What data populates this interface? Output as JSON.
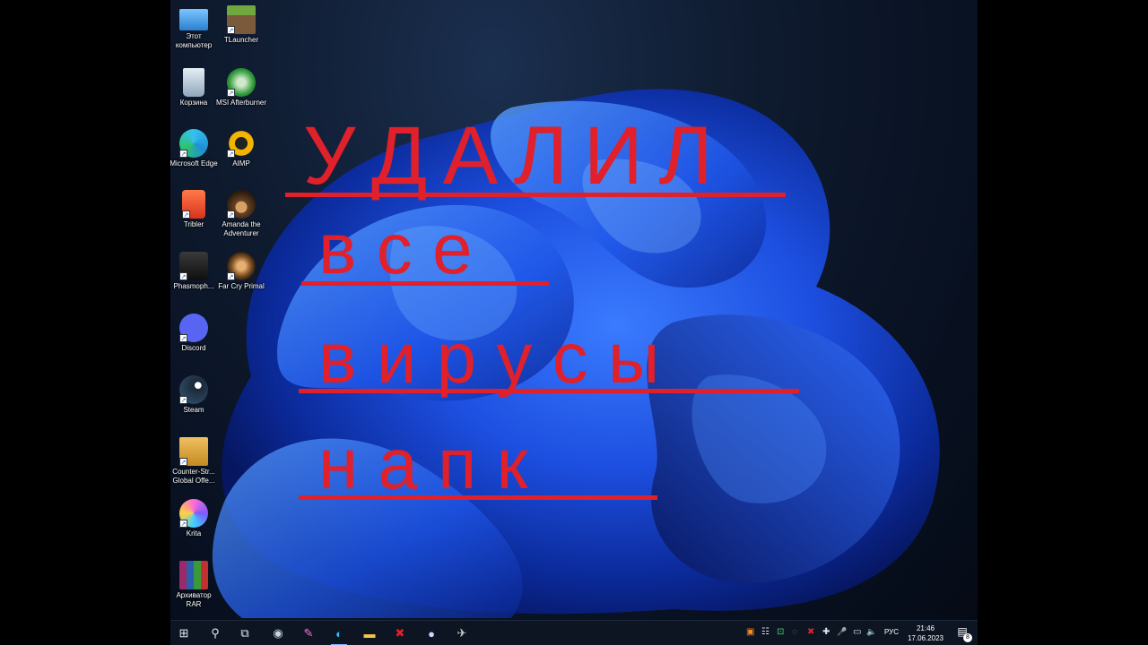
{
  "desktop": {
    "icons": [
      {
        "id": "this-pc",
        "label": "Этот компьютер",
        "icon": "computer-icon",
        "color": "#4aa3e8"
      },
      {
        "id": "tlauncher",
        "label": "TLauncher",
        "icon": "minecraft-block-icon",
        "color": "#5b8c32"
      },
      {
        "id": "recycle-bin",
        "label": "Корзина",
        "icon": "recycle-bin-icon",
        "color": "#9db6cc"
      },
      {
        "id": "msi-afterburner",
        "label": "MSI Afterburner",
        "icon": "afterburner-icon",
        "color": "#2f9a3a"
      },
      {
        "id": "edge",
        "label": "Microsoft Edge",
        "icon": "edge-icon",
        "color": "#1f8fd6"
      },
      {
        "id": "aimp",
        "label": "AIMP",
        "icon": "aimp-icon",
        "color": "#f3b400"
      },
      {
        "id": "tribler",
        "label": "Tribler",
        "icon": "tribler-icon",
        "color": "#e5462f"
      },
      {
        "id": "amanda",
        "label": "Amanda the Adventurer",
        "icon": "amanda-icon",
        "color": "#6b4526"
      },
      {
        "id": "phasmophobia",
        "label": "Phasmoph...",
        "icon": "phasmophobia-icon",
        "color": "#222222"
      },
      {
        "id": "farcry",
        "label": "Far Cry Primal",
        "icon": "farcry-icon",
        "color": "#8a5a2b"
      },
      {
        "id": "discord",
        "label": "Discord",
        "icon": "discord-icon",
        "color": "#5865f2"
      },
      {
        "id": "steam",
        "label": "Steam",
        "icon": "steam-icon",
        "color": "#1b2838"
      },
      {
        "id": "csgo",
        "label": "Counter-Str... Global Offe...",
        "icon": "csgo-icon",
        "color": "#d9a032"
      },
      {
        "id": "krita",
        "label": "Krita",
        "icon": "krita-icon",
        "color": "#c23ab4"
      },
      {
        "id": "winrar",
        "label": "Архиватор RAR",
        "icon": "winrar-icon",
        "color": "#9b2a6a"
      }
    ],
    "shortcut_glyph": "↗"
  },
  "overlay": {
    "line1": "У Д А Л И Л",
    "line2": "в с е",
    "line3": "в и р у с ы",
    "line4": "н а   п к",
    "color": "#e0202a"
  },
  "taskbar": {
    "start_glyph": "⊞",
    "search_glyph": "⚲",
    "taskview_glyph": "⧉",
    "apps": [
      {
        "id": "steam",
        "icon": "steam-icon",
        "glyph": "◉"
      },
      {
        "id": "krita",
        "icon": "krita-icon",
        "glyph": "✎"
      },
      {
        "id": "edge",
        "icon": "edge-icon",
        "glyph": "◐"
      },
      {
        "id": "explorer",
        "icon": "folder-icon",
        "glyph": "▬"
      },
      {
        "id": "app-red",
        "icon": "red-x-app-icon",
        "glyph": "✖"
      },
      {
        "id": "app-badge",
        "icon": "badge-app-icon",
        "glyph": "●"
      },
      {
        "id": "app-bird",
        "icon": "bird-app-icon",
        "glyph": "✈"
      }
    ],
    "tray_glyphs": [
      "▣",
      "☷",
      "⊡",
      "◌",
      "✖",
      "✚",
      "🎤",
      "▭",
      "🔈"
    ],
    "language": "РУС",
    "time": "21:46",
    "date": "17.06.2023",
    "notification_glyph": "▤",
    "notification_count": "8"
  }
}
